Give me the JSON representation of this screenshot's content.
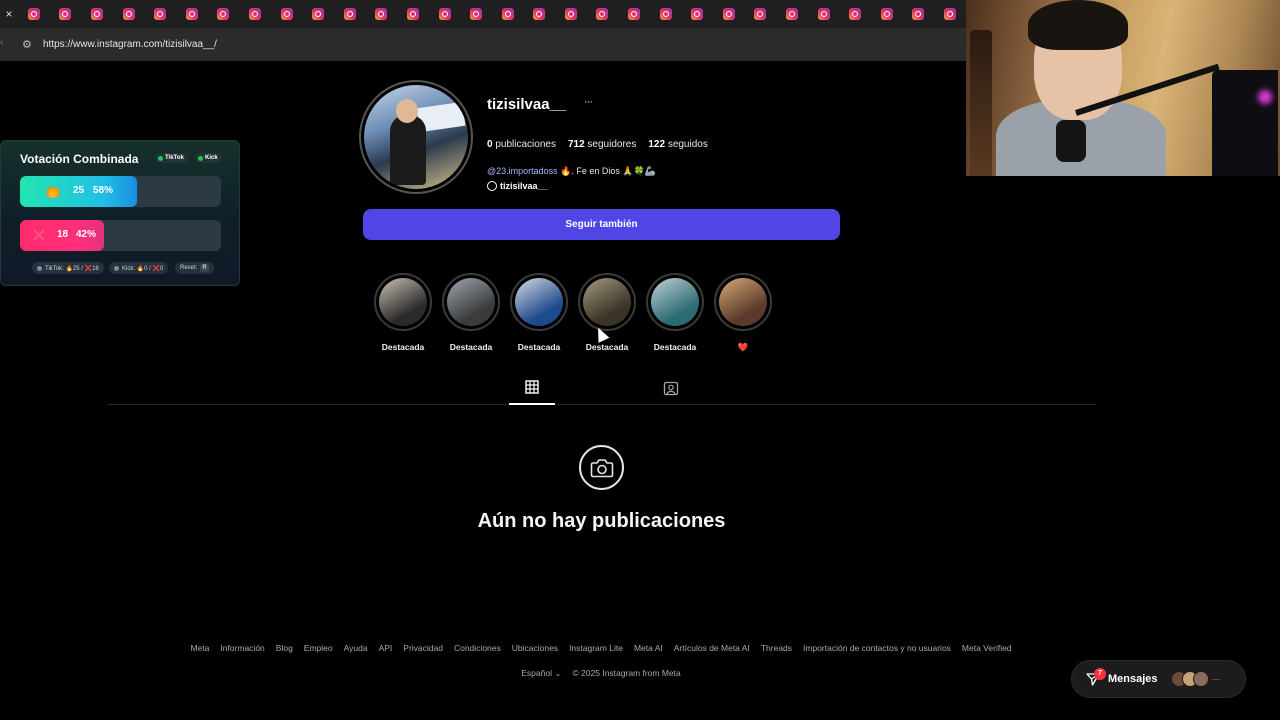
{
  "browser": {
    "close_tab": "×",
    "tab_count": 30,
    "url": "https://www.instagram.com/tizisilvaa__/"
  },
  "vote_widget": {
    "title": "Votación Combinada",
    "platforms": [
      "TikTok",
      "Kick"
    ],
    "option_a": {
      "count": "25",
      "percent": "58%",
      "fill_fraction": 0.58,
      "icon": "fire-icon",
      "color": "#22c0e5"
    },
    "option_b": {
      "count": "18",
      "percent": "42%",
      "fill_fraction": 0.42,
      "icon": "x-icon",
      "color": "#ff2b6b"
    },
    "stats": [
      {
        "label": "TikTok: 🔥25 / ❌18"
      },
      {
        "label": "Kick: 🔥0 / ❌0"
      },
      {
        "label": "Reset:",
        "key": "R"
      }
    ]
  },
  "profile": {
    "username": "tizisilvaa__",
    "more": "···",
    "posts": "0",
    "posts_label": "publicaciones",
    "followers": "712",
    "followers_label": "seguidores",
    "following": "122",
    "following_label": "seguidos",
    "bio_mention": "@23.importadoss",
    "bio_text": "🔥. Fe en Dios 🙏🍀🦾",
    "threads_handle": "tizisilvaa__",
    "follow_button": "Seguir también"
  },
  "highlights": [
    {
      "label": "Destacada",
      "colors": [
        "#2a2a2a",
        "#c9c2b0"
      ]
    },
    {
      "label": "Destacada",
      "colors": [
        "#3b3b3b",
        "#9ea7b0"
      ]
    },
    {
      "label": "Destacada",
      "colors": [
        "#1d4a8c",
        "#d7dbe3"
      ]
    },
    {
      "label": "Destacada",
      "colors": [
        "#3a3326",
        "#a59a82"
      ]
    },
    {
      "label": "Destacada",
      "colors": [
        "#2d6b74",
        "#bfd1d6"
      ]
    },
    {
      "label": "❤️",
      "colors": [
        "#5a3a2a",
        "#d8a878"
      ]
    }
  ],
  "tabs": {
    "posts": "grid-icon",
    "tagged": "tagged-icon"
  },
  "empty_state": {
    "title": "Aún no hay publicaciones"
  },
  "footer": {
    "links": [
      "Meta",
      "Información",
      "Blog",
      "Empleo",
      "Ayuda",
      "API",
      "Privacidad",
      "Condiciones",
      "Ubicaciones",
      "Instagram Lite",
      "Meta AI",
      "Artículos de Meta AI",
      "Threads",
      "Importación de contactos y no usuarios",
      "Meta Verified"
    ],
    "language": "Español",
    "copyright": "© 2025 Instagram from Meta"
  },
  "messages": {
    "label": "Mensajes",
    "badge": "7",
    "more": "···"
  }
}
